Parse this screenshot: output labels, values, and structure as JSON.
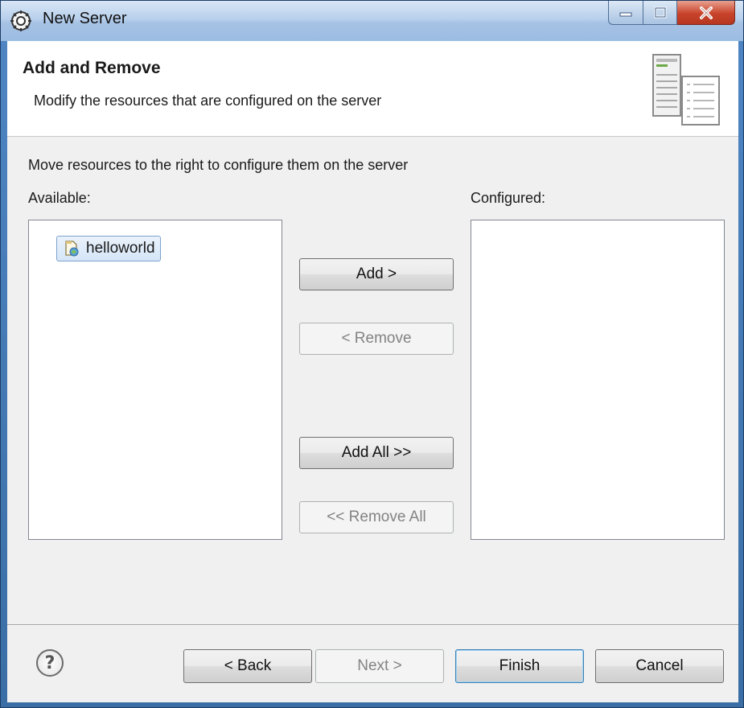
{
  "window": {
    "title": "New Server",
    "controls": {
      "minimize_icon": "minimize-icon",
      "maximize_icon": "maximize-icon",
      "close_icon": "close-icon"
    }
  },
  "banner": {
    "title": "Add and Remove",
    "description": "Modify the resources that are configured on the server",
    "graphic_icon": "server-config-icon"
  },
  "instruction": "Move resources to the right to configure them on the server",
  "available": {
    "label": "Available:",
    "items": [
      {
        "label": "helloworld",
        "icon": "web-project-icon",
        "selected": true
      }
    ]
  },
  "configured": {
    "label": "Configured:",
    "items": []
  },
  "transfer_buttons": {
    "add": "Add >",
    "remove": "< Remove",
    "add_all": "Add All >>",
    "remove_all": "<< Remove All"
  },
  "footer": {
    "help_icon": "help-icon",
    "back": "< Back",
    "next": "Next >",
    "finish": "Finish",
    "cancel": "Cancel"
  },
  "colors": {
    "titlebar": "#a6c2e4",
    "dialog_bg": "#f0f0f0",
    "selection_border": "#7da2ce",
    "close_button": "#c8432a"
  }
}
